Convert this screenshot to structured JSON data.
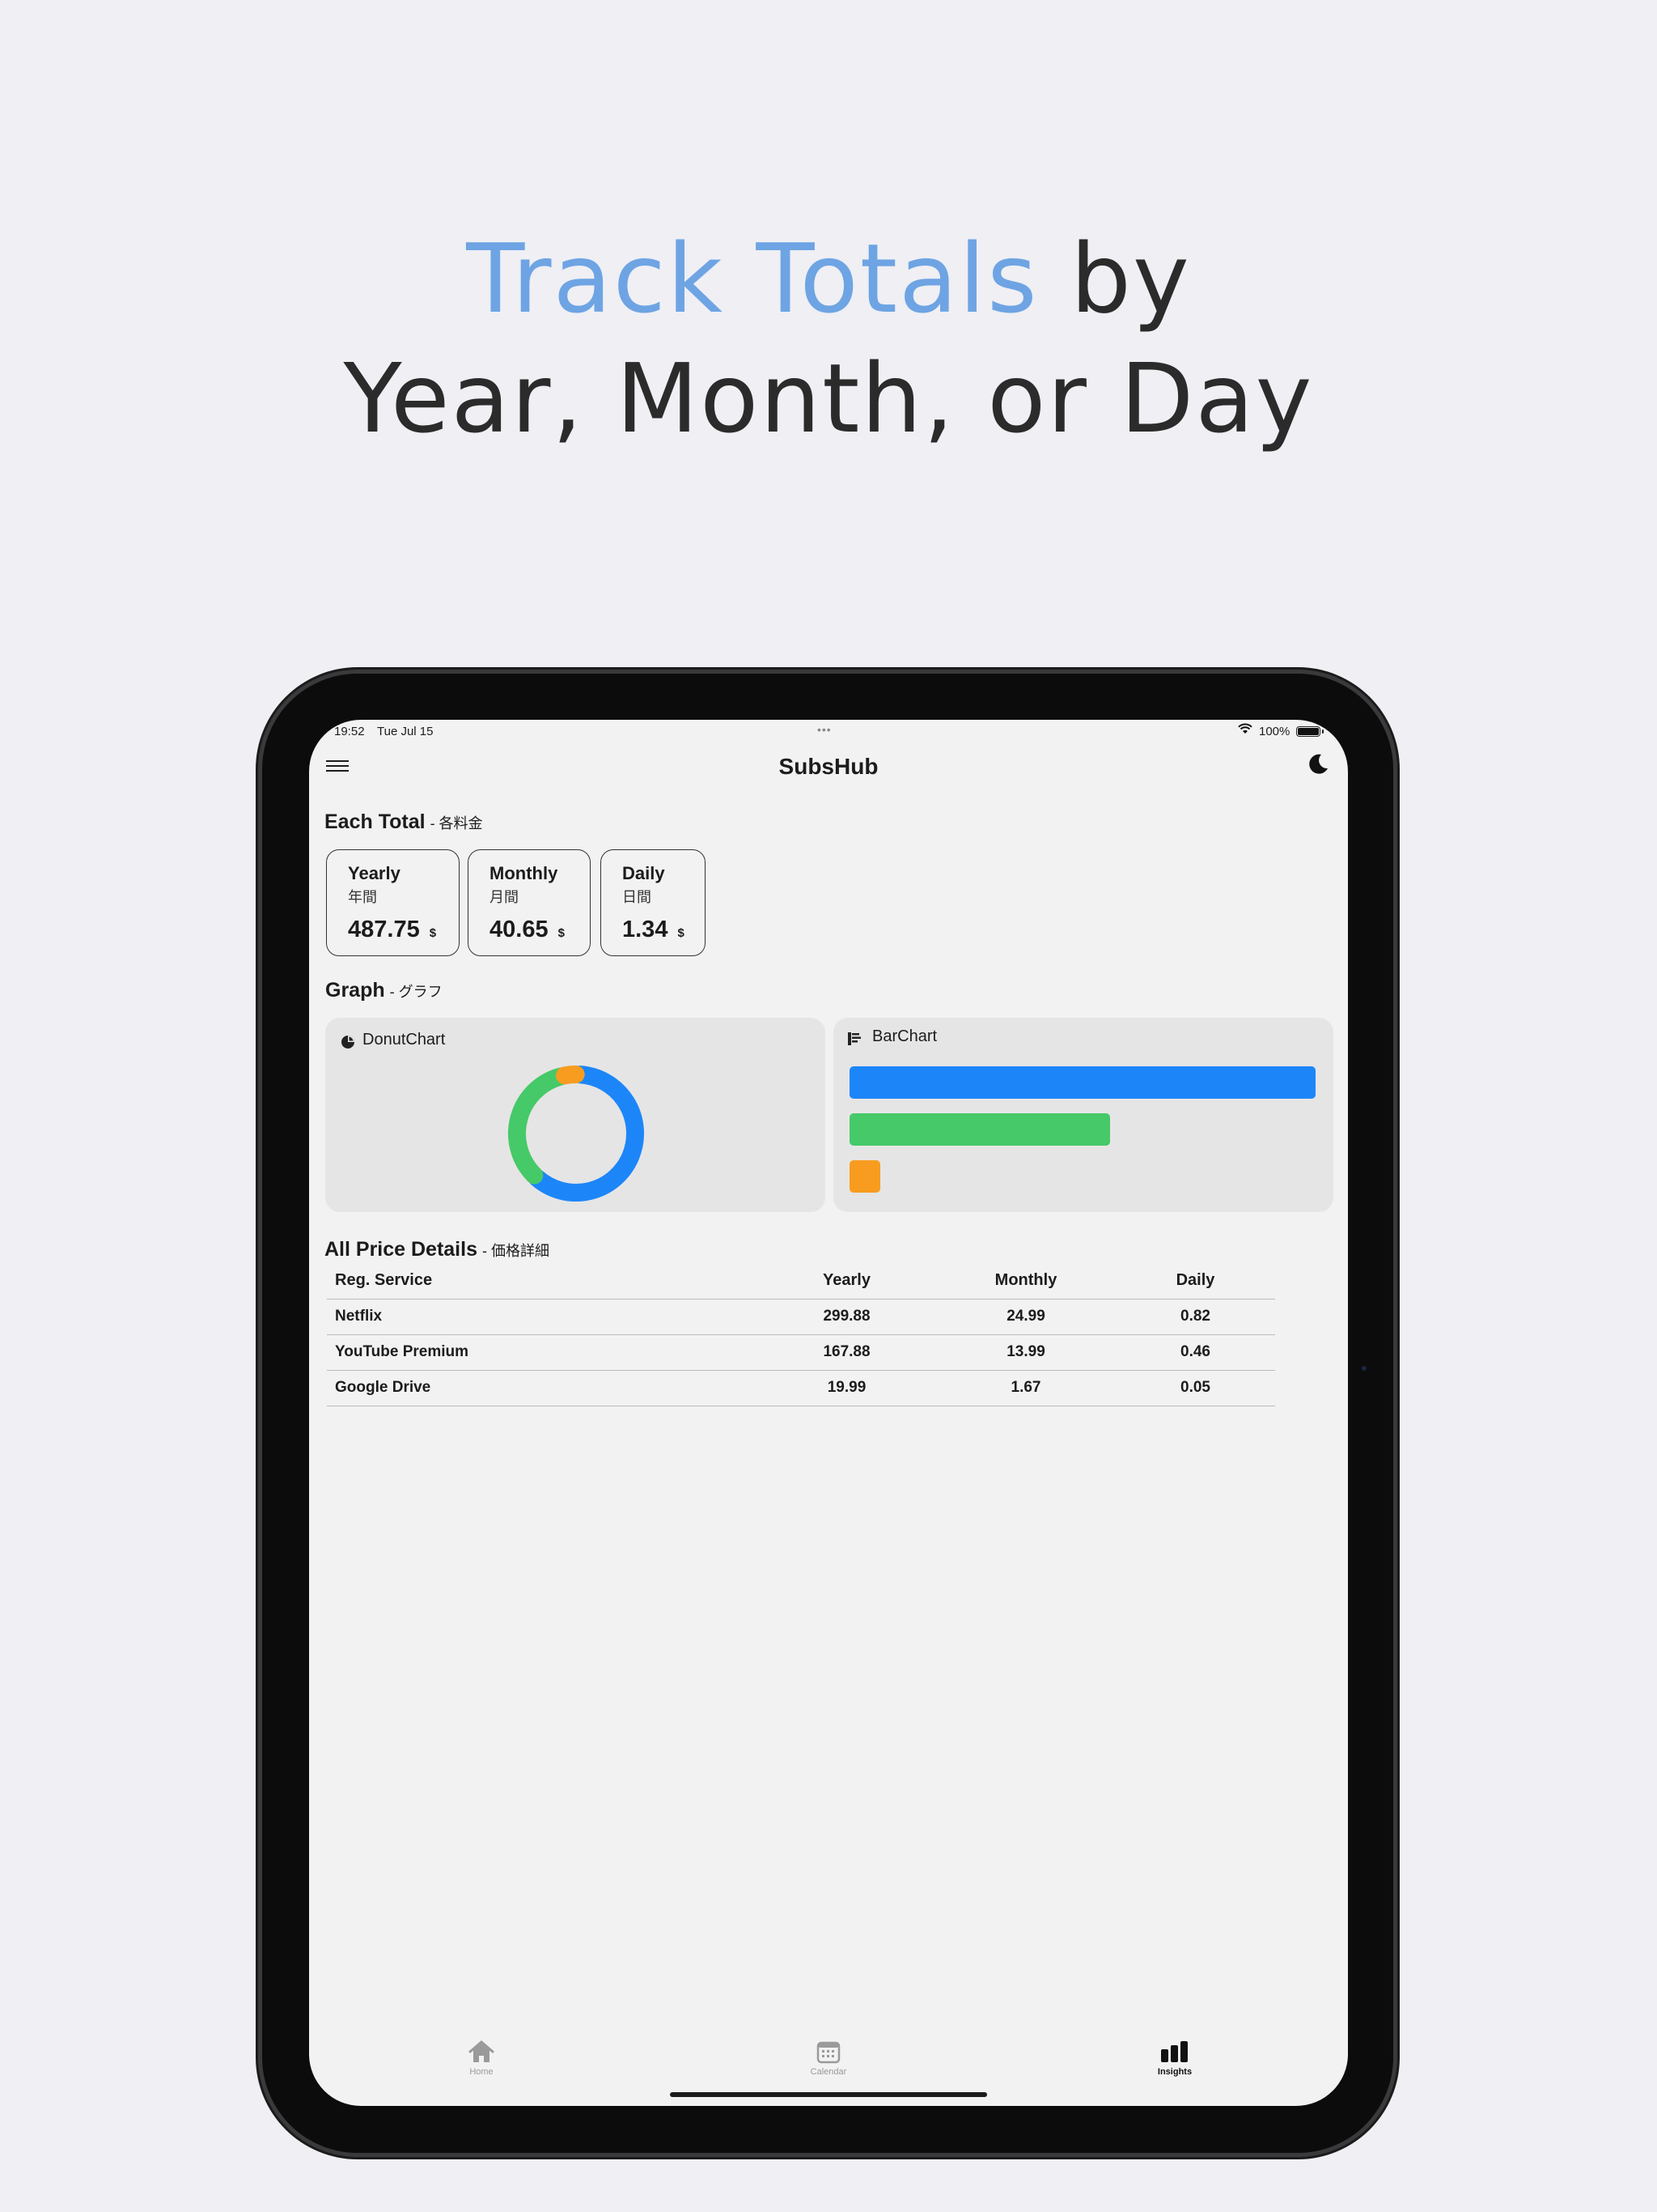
{
  "headline": {
    "accent": "Track Totals",
    "rest1": " by",
    "line2": "Year, Month, or Day"
  },
  "status_bar": {
    "time": "19:52",
    "date": "Tue Jul 15",
    "battery": "100%"
  },
  "app": {
    "title": "SubsHub",
    "menu_icon": "hamburger-icon",
    "theme_icon": "moon-icon"
  },
  "each_total": {
    "title": "Each Total",
    "subtitle": "- 各料金",
    "cards": [
      {
        "name": "Yearly",
        "jp": "年間",
        "value": "487.75",
        "currency": "$"
      },
      {
        "name": "Monthly",
        "jp": "月間",
        "value": "40.65",
        "currency": "$"
      },
      {
        "name": "Daily",
        "jp": "日間",
        "value": "1.34",
        "currency": "$"
      }
    ]
  },
  "graph": {
    "title": "Graph",
    "subtitle": "- グラフ",
    "donut_label": "DonutChart",
    "bar_label": "BarChart",
    "colors": [
      "#1c86f9",
      "#46c968",
      "#f79c1f"
    ]
  },
  "chart_data": [
    {
      "type": "pie",
      "title": "DonutChart",
      "series": [
        {
          "values": [
            299.88,
            167.88,
            19.99
          ]
        }
      ]
    },
    {
      "type": "bar",
      "title": "BarChart",
      "orientation": "horizontal",
      "values": [
        299.88,
        167.88,
        19.99
      ]
    }
  ],
  "price_details": {
    "title": "All Price Details",
    "subtitle": "- 価格詳細",
    "columns": [
      "Reg. Service",
      "Yearly",
      "Monthly",
      "Daily"
    ],
    "rows": [
      [
        "Netflix",
        "299.88",
        "24.99",
        "0.82"
      ],
      [
        "YouTube Premium",
        "167.88",
        "13.99",
        "0.46"
      ],
      [
        "Google Drive",
        "19.99",
        "1.67",
        "0.05"
      ]
    ]
  },
  "tabs": [
    {
      "label": "Home",
      "icon": "house-icon"
    },
    {
      "label": "Calendar",
      "icon": "calendar-icon"
    },
    {
      "label": "Insights",
      "icon": "chart-bar-icon",
      "active": true
    }
  ]
}
